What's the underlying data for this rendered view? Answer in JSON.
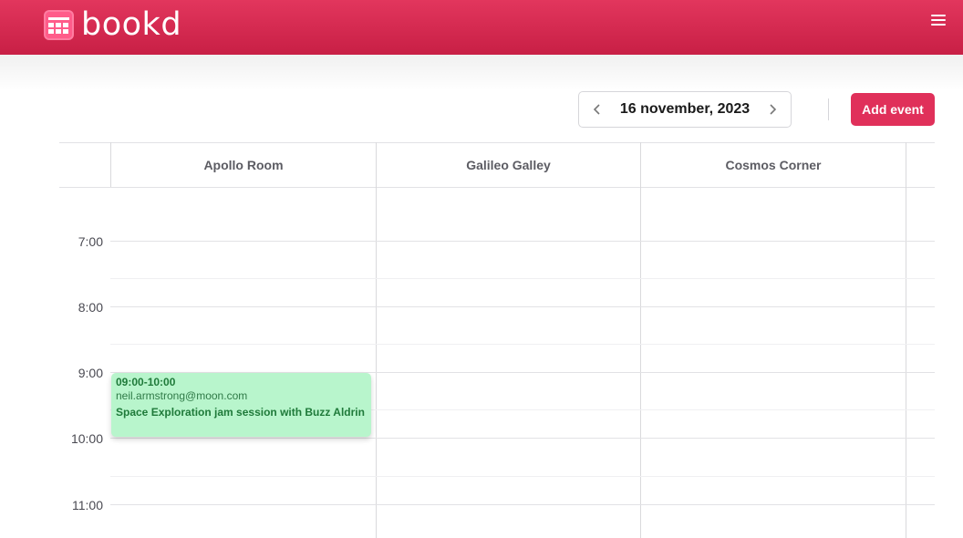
{
  "app": {
    "name": "bookd"
  },
  "icons": {
    "logo": "calendar-grid-icon",
    "menu": "hamburger-menu-icon",
    "prev": "chevron-left-icon",
    "next": "chevron-right-icon"
  },
  "colors": {
    "brand": "#e0305a",
    "event_bg": "#b8f5cc",
    "event_text": "#1f7a3a"
  },
  "toolbar": {
    "date": "16 november, 2023",
    "add_event_label": "Add event"
  },
  "calendar": {
    "rooms": [
      "Apollo Room",
      "Galileo Galley",
      "Cosmos Corner"
    ],
    "times": [
      "7:00",
      "8:00",
      "9:00",
      "10:00",
      "11:00"
    ],
    "events": [
      {
        "room": "Apollo Room",
        "time": "09:00-10:00",
        "email": "neil.armstrong@moon.com",
        "title": "Space Exploration jam session with Buzz Aldrin"
      }
    ]
  }
}
